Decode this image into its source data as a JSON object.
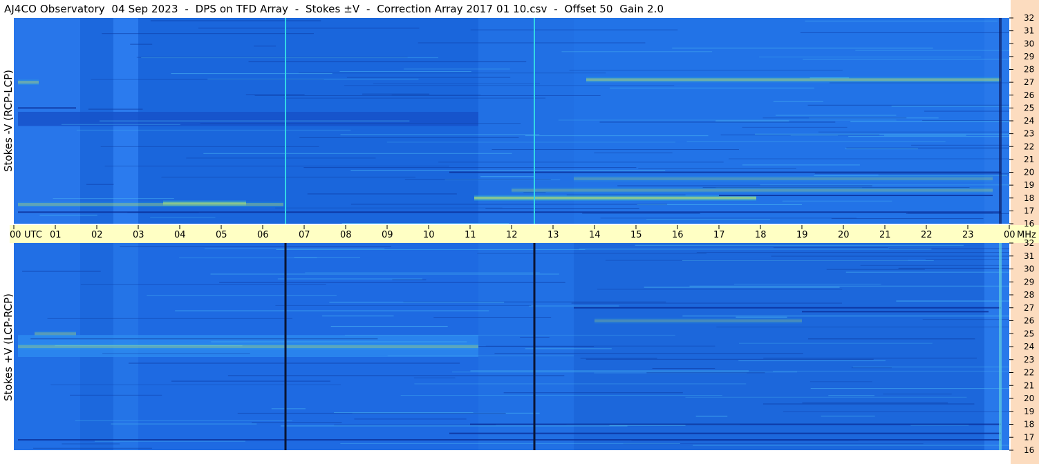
{
  "header": {
    "title": "AJ4CO Observatory  04 Sep 2023  -  DPS on TFD Array  -  Stokes ±V  -  Correction Array 2017 01 10.csv  -  Offset 50  Gain 2.0"
  },
  "panels": {
    "top_label": "Stokes -V (RCP-LCP)",
    "bottom_label": "Stokes +V (LCP-RCP)"
  },
  "colors": {
    "base_blue": "#1f6fe6",
    "title_bg": "#ffffff",
    "time_strip": "#ffffc4",
    "freq_strip": "#fcdcbf",
    "cyan_marker": "#33d6e6",
    "dark_marker": "#0a1433",
    "band_hot": "#e6e64d",
    "band_cool": "#0a2e99"
  },
  "chart_data": {
    "type": "heatmap",
    "title": "AJ4CO Observatory  04 Sep 2023  -  DPS on TFD Array  -  Stokes ±V  -  Correction Array 2017 01 10.csv  -  Offset 50  Gain 2.0",
    "x_unit_label": "UTC",
    "y_unit_label": "MHz",
    "x_ticks": [
      "00",
      "01",
      "02",
      "03",
      "04",
      "05",
      "06",
      "07",
      "08",
      "09",
      "10",
      "11",
      "12",
      "13",
      "14",
      "15",
      "16",
      "17",
      "18",
      "19",
      "20",
      "21",
      "22",
      "23",
      "00"
    ],
    "y_ticks": [
      "32",
      "31",
      "30",
      "29",
      "28",
      "27",
      "26",
      "25",
      "24",
      "23",
      "22",
      "21",
      "20",
      "19",
      "18",
      "17",
      "16"
    ],
    "xlim": [
      0,
      24
    ],
    "ylim": [
      16,
      32
    ],
    "grid": false,
    "series": [
      {
        "name": "Stokes -V (RCP-LCP)",
        "markers_utc": [
          6.55,
          12.55
        ],
        "bright_bands": [
          {
            "freq": 27.2,
            "from": 13.8,
            "to": 23.8,
            "strength": 0.6
          },
          {
            "freq": 27.0,
            "from": 0.1,
            "to": 0.6,
            "strength": 0.5
          },
          {
            "freq": 18.0,
            "from": 11.1,
            "to": 17.9,
            "strength": 0.9
          },
          {
            "freq": 17.6,
            "from": 3.6,
            "to": 5.6,
            "strength": 0.7
          },
          {
            "freq": 17.5,
            "from": 0.1,
            "to": 6.5,
            "strength": 0.45
          },
          {
            "freq": 18.6,
            "from": 12.0,
            "to": 23.6,
            "strength": 0.35
          },
          {
            "freq": 19.5,
            "from": 13.5,
            "to": 23.6,
            "strength": 0.3
          }
        ],
        "dark_bands": [
          {
            "freq": 16.9,
            "from": 0.1,
            "to": 23.8
          },
          {
            "freq": 20.0,
            "from": 10.5,
            "to": 23.8
          },
          {
            "freq": 18.2,
            "from": 17.0,
            "to": 23.6
          },
          {
            "freq": 25.0,
            "from": 0.1,
            "to": 1.5
          }
        ]
      },
      {
        "name": "Stokes +V (LCP-RCP)",
        "markers_utc": [
          6.55,
          12.55
        ],
        "bright_bands": [
          {
            "freq": 24.0,
            "from": 0.1,
            "to": 11.2,
            "strength": 0.4
          },
          {
            "freq": 25.0,
            "from": 0.5,
            "to": 1.5,
            "strength": 0.4
          },
          {
            "freq": 26.0,
            "from": 14.0,
            "to": 19.0,
            "strength": 0.3
          }
        ],
        "dark_bands": [
          {
            "freq": 27.0,
            "from": 13.5,
            "to": 23.8
          },
          {
            "freq": 26.7,
            "from": 19.0,
            "to": 23.5
          },
          {
            "freq": 18.0,
            "from": 11.0,
            "to": 23.8
          },
          {
            "freq": 17.3,
            "from": 10.5,
            "to": 23.8
          },
          {
            "freq": 16.8,
            "from": 0.1,
            "to": 23.8
          }
        ]
      }
    ]
  }
}
